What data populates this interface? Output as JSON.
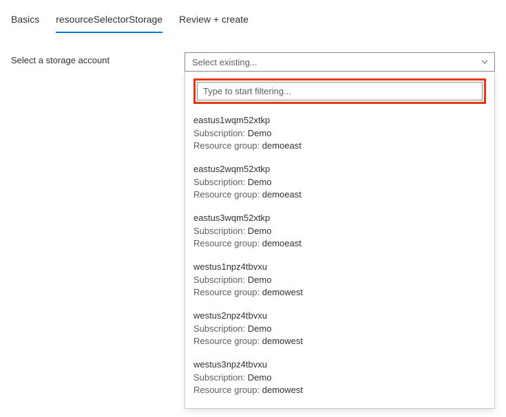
{
  "tabs": [
    {
      "label": "Basics"
    },
    {
      "label": "resourceSelectorStorage"
    },
    {
      "label": "Review + create"
    }
  ],
  "form": {
    "label": "Select a storage account",
    "select_placeholder": "Select existing...",
    "filter_placeholder": "Type to start filtering..."
  },
  "meta_labels": {
    "subscription": "Subscription:",
    "resource_group": "Resource group:"
  },
  "options": [
    {
      "name": "eastus1wqm52xtkp",
      "subscription": "Demo",
      "resource_group": "demoeast"
    },
    {
      "name": "eastus2wqm52xtkp",
      "subscription": "Demo",
      "resource_group": "demoeast"
    },
    {
      "name": "eastus3wqm52xtkp",
      "subscription": "Demo",
      "resource_group": "demoeast"
    },
    {
      "name": "westus1npz4tbvxu",
      "subscription": "Demo",
      "resource_group": "demowest"
    },
    {
      "name": "westus2npz4tbvxu",
      "subscription": "Demo",
      "resource_group": "demowest"
    },
    {
      "name": "westus3npz4tbvxu",
      "subscription": "Demo",
      "resource_group": "demowest"
    }
  ]
}
